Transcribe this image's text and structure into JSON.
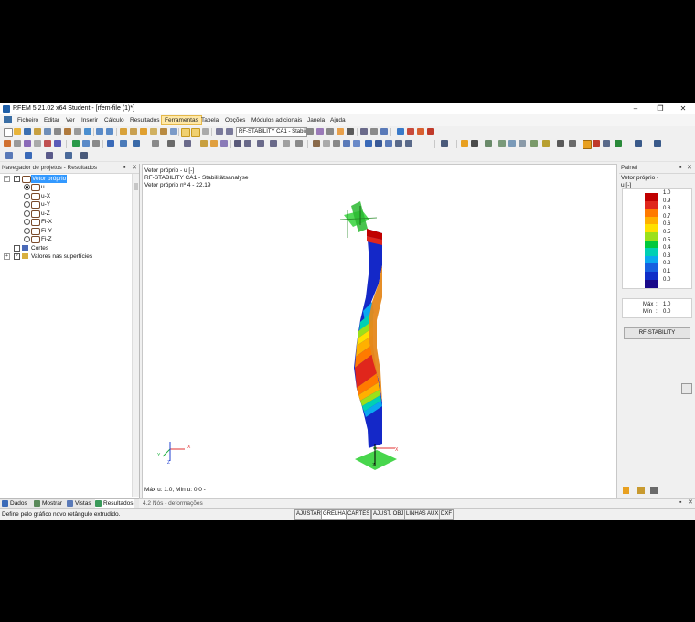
{
  "window": {
    "title": "RFEM 5.21.02 x64 Student - [rfem-file (1)*]",
    "minimize": "–",
    "restore": "❐",
    "close": "✕"
  },
  "menu": [
    "Ficheiro",
    "Editar",
    "Ver",
    "Inserir",
    "Cálculo",
    "Resultados",
    "Ferramentas",
    "Tabela",
    "Opções",
    "Módulos adicionais",
    "Janela",
    "Ajuda"
  ],
  "menu_active": "Ferramentas",
  "toolbar": {
    "case_combo": "RF-STABILITY CA1 - Stabilit"
  },
  "navigator": {
    "title": "Navegador de projetos - Resultados",
    "pin": "📌",
    "close": "✕",
    "root": "Vetor próprio",
    "items": [
      "u",
      "u-X",
      "u-Y",
      "u-Z",
      "Fi-X",
      "Fi-Y",
      "Fi-Z"
    ],
    "selected_item": "u",
    "cortes": "Cortes",
    "surfaces": "Valores nas superfícies",
    "tabs": [
      "Dados",
      "Mostrar",
      "Vistas",
      "Resultados"
    ]
  },
  "viewport": {
    "line1": "Vetor próprio - u [-]",
    "line2": "RF-STABILITY CA1 - Stabilitätsanalyse",
    "line3": "Vetor próprio nº 4  -  22.19",
    "footer": "Máx u: 1.0, Mín u: 0.0 -",
    "axis_x": "X",
    "axis_y": "Y",
    "axis_z": "Z"
  },
  "panel": {
    "title": "Painel",
    "pin": "📌",
    "close": "✕",
    "label1": "Vetor próprio -",
    "label2": "u [-]",
    "scale": [
      {
        "label": "1.0",
        "color": "#c00000"
      },
      {
        "label": "0.9",
        "color": "#e0261c"
      },
      {
        "label": "0.8",
        "color": "#ff7a00"
      },
      {
        "label": "0.7",
        "color": "#ffb000"
      },
      {
        "label": "0.6",
        "color": "#ffe000"
      },
      {
        "label": "0.5",
        "color": "#9be01a"
      },
      {
        "label": "0.5",
        "color": "#00c83c"
      },
      {
        "label": "0.4",
        "color": "#00d0b4"
      },
      {
        "label": "0.3",
        "color": "#0aa8f0"
      },
      {
        "label": "0.2",
        "color": "#1660e0"
      },
      {
        "label": "0.1",
        "color": "#0e2ec8"
      },
      {
        "label": "0.0",
        "color": "#1a0a8a"
      }
    ],
    "max_label": "Máx",
    "max_value": "1.0",
    "min_label": "Mín",
    "min_value": "0.0",
    "button": "RF-STABILITY"
  },
  "bottom": {
    "title": "4.2 Nós - deformações"
  },
  "status": {
    "hint": "Define pelo gráfico novo retângulo extrudido.",
    "toggles": [
      "AJUSTAR",
      "GRELHA",
      "CARTES",
      "AJUST. OBJ",
      "LINHAS AUX.",
      "DXF"
    ],
    "active": "GRELHA"
  }
}
